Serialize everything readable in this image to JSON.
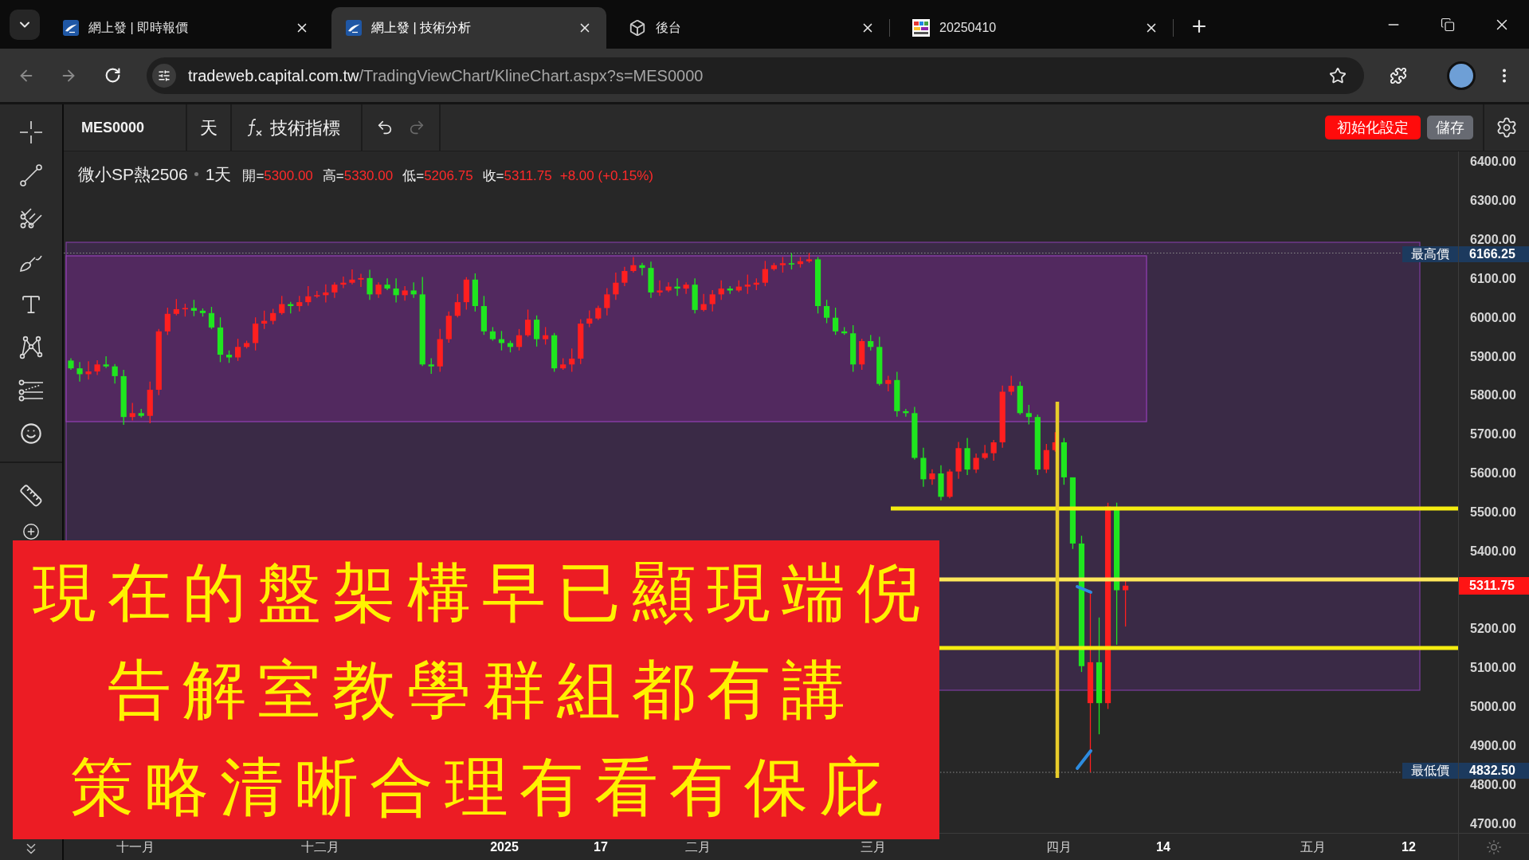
{
  "browser": {
    "tabs": [
      {
        "title": "網上發 | 即時報價",
        "kind": "site",
        "selected": false
      },
      {
        "title": "網上發 | 技術分析",
        "kind": "site",
        "selected": true
      },
      {
        "title": "後台",
        "kind": "cube",
        "selected": false
      },
      {
        "title": "20250410",
        "kind": "thumbnail",
        "selected": false
      }
    ],
    "nav": {
      "back": {
        "disabled": true
      },
      "forward": {
        "disabled": true
      }
    },
    "address": {
      "host": "tradeweb.capital.com.tw",
      "path": "/TradingViewChart/KlineChart.aspx?s=MES0000"
    }
  },
  "toolbar": {
    "symbol": "MES0000",
    "interval": "天",
    "indicators": "技術指標",
    "undo": {
      "disabled": false
    },
    "redo": {
      "disabled": true
    },
    "buttons": [
      {
        "label": "初始化設定",
        "kind": "danger"
      },
      {
        "label": "儲存",
        "kind": "neutral"
      }
    ]
  },
  "chart": {
    "legend": {
      "symbol": "微小SP熱2506",
      "interval": "1天",
      "ohlc": [
        {
          "label": "開=",
          "value": "5300.00"
        },
        {
          "label": "高=",
          "value": "5330.00"
        },
        {
          "label": "低=",
          "value": "5206.75"
        },
        {
          "label": "收=",
          "value": "5311.75"
        }
      ],
      "change": "+8.00 (+0.15%)"
    },
    "price_axis": {
      "ticks": [
        "6400.00",
        "6300.00",
        "6200.00",
        "6100.00",
        "6000.00",
        "5900.00",
        "5800.00",
        "5700.00",
        "5600.00",
        "5500.00",
        "5400.00",
        "5200.00",
        "5100.00",
        "5000.00",
        "4900.00",
        "4800.00",
        "4700.00"
      ],
      "markers": [
        {
          "kind": "high",
          "label": "最高價",
          "value": "6166.25"
        },
        {
          "kind": "last",
          "value": "5311.75"
        },
        {
          "kind": "low",
          "label": "最低價",
          "value": "4832.50"
        }
      ]
    },
    "time_axis": {
      "labels": [
        {
          "text": "十一月",
          "kind": "month"
        },
        {
          "text": "十二月",
          "kind": "month"
        },
        {
          "text": "2025",
          "kind": "year"
        },
        {
          "text": "17",
          "kind": "day"
        },
        {
          "text": "二月",
          "kind": "month"
        },
        {
          "text": "三月",
          "kind": "month"
        },
        {
          "text": "四月",
          "kind": "month"
        },
        {
          "text": "14",
          "kind": "day"
        },
        {
          "text": "五月",
          "kind": "month"
        },
        {
          "text": "12",
          "kind": "day"
        }
      ]
    }
  },
  "banner": {
    "lines": [
      "現在的盤架構早已顯現端倪",
      "告解室教學群組都有講",
      "策略清晰合理有看有保庇"
    ]
  }
}
